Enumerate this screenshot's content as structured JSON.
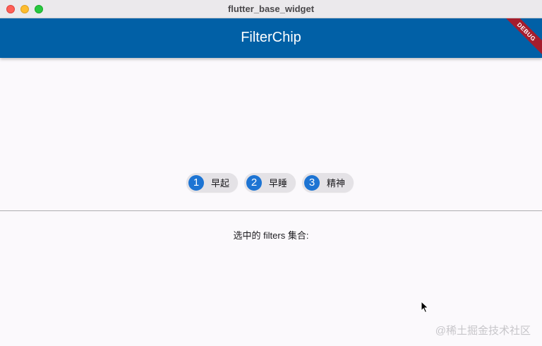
{
  "window": {
    "title": "flutter_base_widget"
  },
  "appbar": {
    "title": "FilterChip",
    "debug_banner": "DEBUG"
  },
  "chips": [
    {
      "avatar": "1",
      "label": "早起"
    },
    {
      "avatar": "2",
      "label": "早睡"
    },
    {
      "avatar": "3",
      "label": "精神"
    }
  ],
  "filters_label": "选中的 filters 集合:",
  "watermark": "@稀土掘金技术社区",
  "colors": {
    "appbar": "#0160a6",
    "avatar": "#1d74d3",
    "chip_bg": "#e4e2e6",
    "debug": "#a51d2d"
  }
}
